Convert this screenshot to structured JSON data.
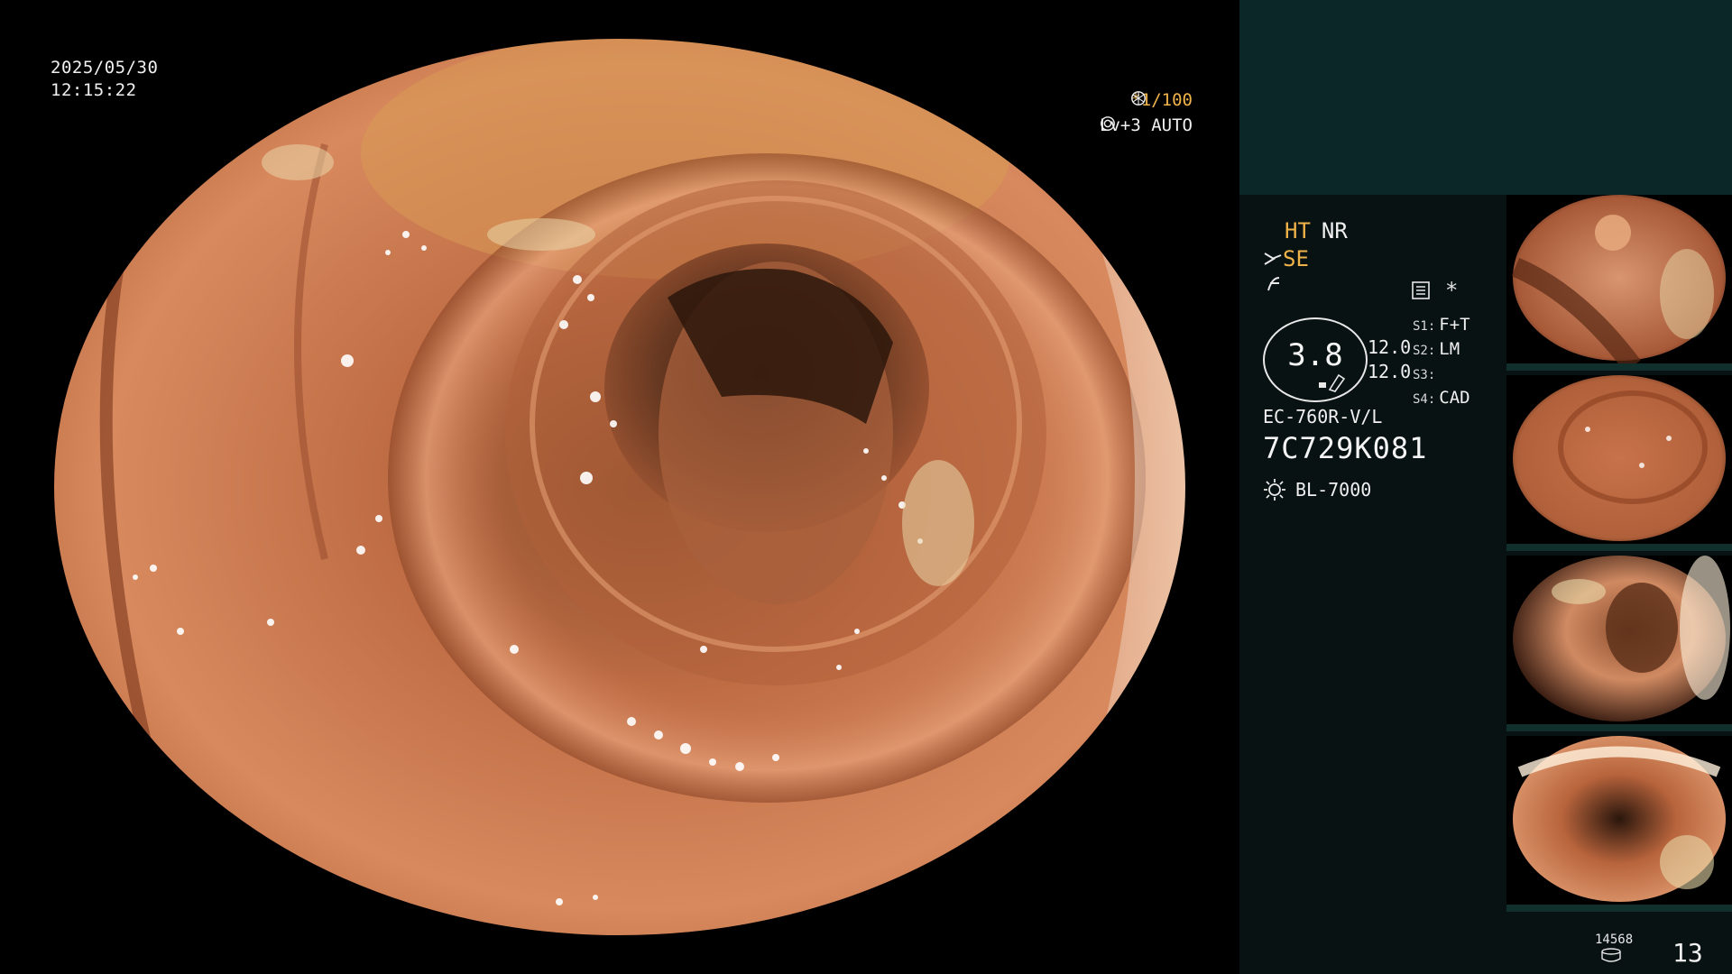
{
  "overlay": {
    "date": "2025/05/30",
    "time": "12:15:22",
    "shutter": "*1/100",
    "level": "Lv+3 AUTO"
  },
  "icons": {
    "shutter": "aperture-icon",
    "auto": "iris-icon",
    "scissors": "scissors-icon",
    "filter": "filter-icon",
    "menu": "menu-icon",
    "light": "lamp-icon",
    "disk": "storage-icon"
  },
  "panel": {
    "ht": "HT",
    "nr": "NR",
    "se": "SE",
    "asterisk": "*",
    "oval_value": "3.8",
    "val_a": "12.0",
    "val_b": "12.0",
    "s_items": [
      {
        "key": "S1:",
        "value": "F+T"
      },
      {
        "key": "S2:",
        "value": "LM"
      },
      {
        "key": "S3:",
        "value": ""
      },
      {
        "key": "S4:",
        "value": "CAD"
      }
    ],
    "scope_model": "EC-760R-V/L",
    "scope_serial": "7C729K081",
    "light_source": "BL-7000"
  },
  "footer": {
    "capture_count": "14568",
    "page": "13"
  },
  "colors": {
    "accent": "#f0b34a",
    "panel_top": "#0b2727",
    "panel_body": "#081212"
  }
}
